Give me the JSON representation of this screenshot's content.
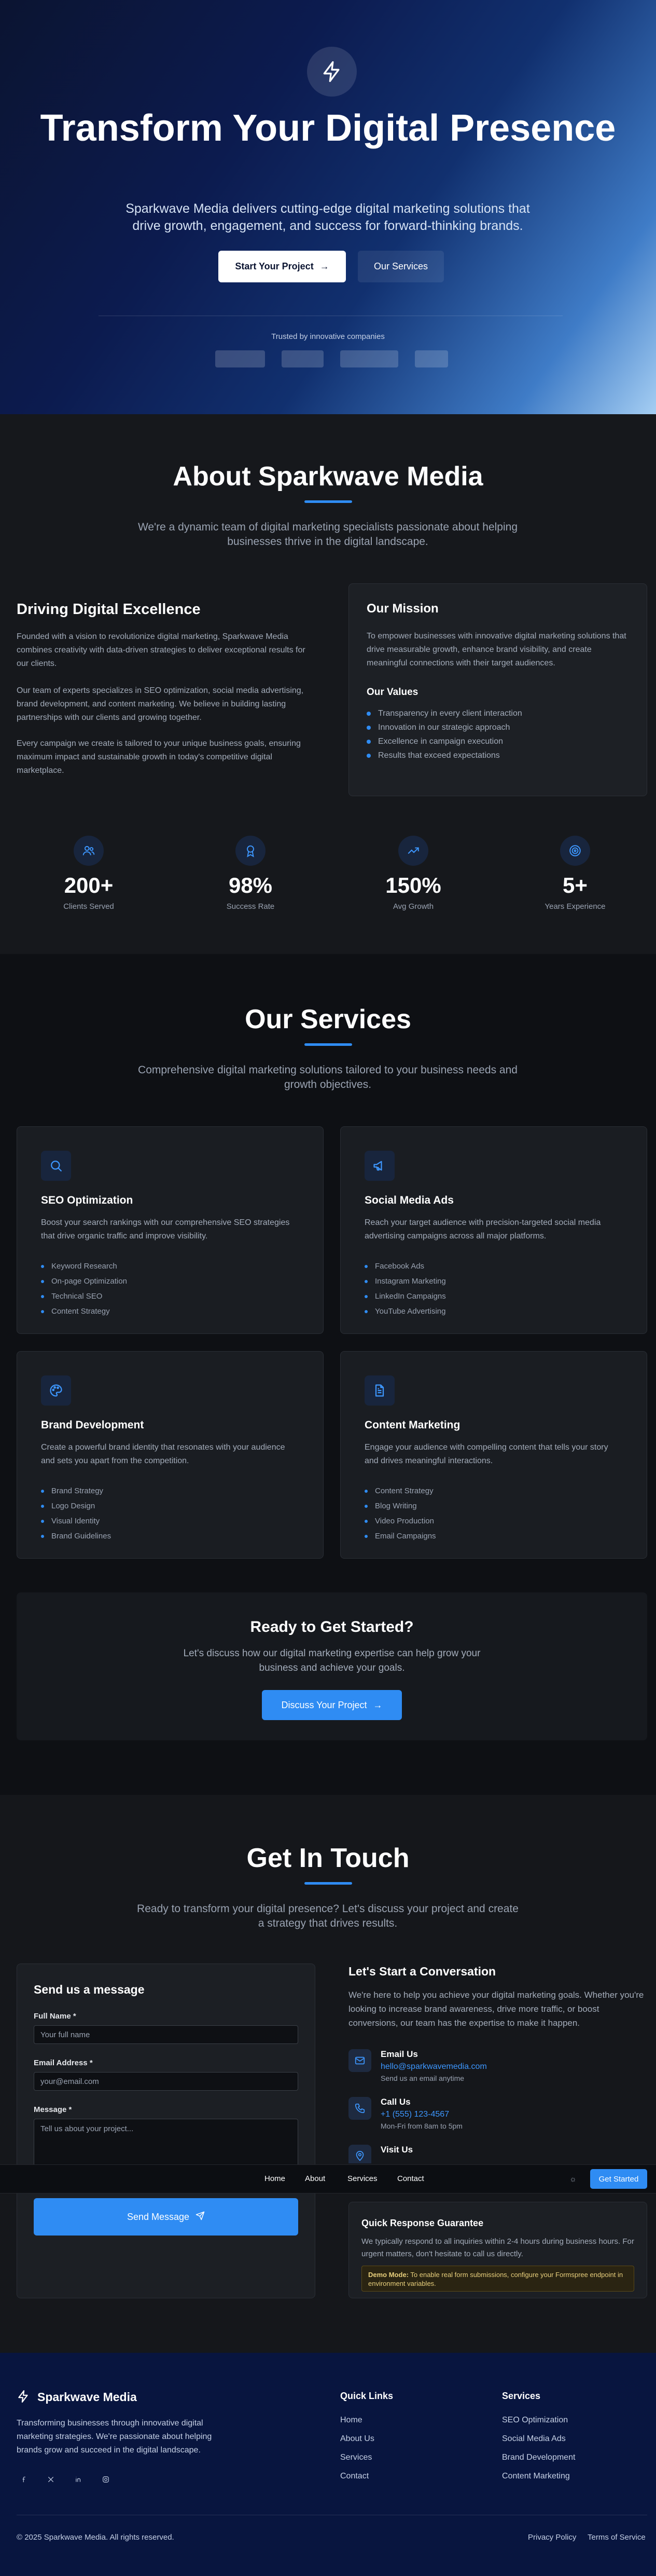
{
  "hero": {
    "icon": "lightning-icon",
    "title": "Transform Your Digital Presence",
    "subtitle": "Sparkwave Media delivers cutting-edge digital marketing solutions that drive growth, engagement, and success for forward-thinking brands.",
    "primary_button": "Start Your Project",
    "secondary_button": "Our Services",
    "trusted_label": "Trusted by innovative companies"
  },
  "about": {
    "title": "About Sparkwave Media",
    "subtitle": "We're a dynamic team of digital marketing specialists passionate about helping businesses thrive in the digital landscape.",
    "heading": "Driving Digital Excellence",
    "paragraphs": [
      "Founded with a vision to revolutionize digital marketing, Sparkwave Media combines creativity with data-driven strategies to deliver exceptional results for our clients.",
      "Our team of experts specializes in SEO optimization, social media advertising, brand development, and content marketing. We believe in building lasting partnerships with our clients and growing together.",
      "Every campaign we create is tailored to your unique business goals, ensuring maximum impact and sustainable growth in today's competitive digital marketplace."
    ],
    "mission": {
      "title": "Our Mission",
      "text": "To empower businesses with innovative digital marketing solutions that drive measurable growth, enhance brand visibility, and create meaningful connections with their target audiences.",
      "values_title": "Our Values",
      "values": [
        "Transparency in every client interaction",
        "Innovation in our strategic approach",
        "Excellence in campaign execution",
        "Results that exceed expectations"
      ]
    },
    "stats": [
      {
        "icon": "users-icon",
        "value": "200+",
        "label": "Clients Served"
      },
      {
        "icon": "award-icon",
        "value": "98%",
        "label": "Success Rate"
      },
      {
        "icon": "trending-up-icon",
        "value": "150%",
        "label": "Avg Growth"
      },
      {
        "icon": "target-icon",
        "value": "5+",
        "label": "Years Experience"
      }
    ]
  },
  "services": {
    "title": "Our Services",
    "subtitle": "Comprehensive digital marketing solutions tailored to your business needs and growth objectives.",
    "items": [
      {
        "icon": "search-icon",
        "title": "SEO Optimization",
        "desc": "Boost your search rankings with our comprehensive SEO strategies that drive organic traffic and improve visibility.",
        "features": [
          "Keyword Research",
          "On-page Optimization",
          "Technical SEO",
          "Content Strategy"
        ]
      },
      {
        "icon": "megaphone-icon",
        "title": "Social Media Ads",
        "desc": "Reach your target audience with precision-targeted social media advertising campaigns across all major platforms.",
        "features": [
          "Facebook Ads",
          "Instagram Marketing",
          "LinkedIn Campaigns",
          "YouTube Advertising"
        ]
      },
      {
        "icon": "palette-icon",
        "title": "Brand Development",
        "desc": "Create a powerful brand identity that resonates with your audience and sets you apart from the competition.",
        "features": [
          "Brand Strategy",
          "Logo Design",
          "Visual Identity",
          "Brand Guidelines"
        ]
      },
      {
        "icon": "document-icon",
        "title": "Content Marketing",
        "desc": "Engage your audience with compelling content that tells your story and drives meaningful interactions.",
        "features": [
          "Content Strategy",
          "Blog Writing",
          "Video Production",
          "Email Campaigns"
        ]
      }
    ],
    "cta": {
      "title": "Ready to Get Started?",
      "text": "Let's discuss how our digital marketing expertise can help grow your business and achieve your goals.",
      "button": "Discuss Your Project"
    }
  },
  "contact": {
    "title": "Get In Touch",
    "subtitle": "Ready to transform your digital presence? Let's discuss your project and create a strategy that drives results.",
    "form": {
      "title": "Send us a message",
      "name_label": "Full Name *",
      "name_placeholder": "Your full name",
      "email_label": "Email Address *",
      "email_placeholder": "your@email.com",
      "message_label": "Message *",
      "message_placeholder": "Tell us about your project...",
      "submit": "Send Message"
    },
    "conversation": {
      "title": "Let's Start a Conversation",
      "text": "We're here to help you achieve your digital marketing goals. Whether you're looking to increase brand awareness, drive more traffic, or boost conversions, our team has the expertise to make it happen.",
      "email_title": "Email Us",
      "email_value": "hello@sparkwavemedia.com",
      "email_sub": "Send us an email anytime",
      "call_title": "Call Us",
      "call_value": "+1 (555) 123-4567",
      "call_sub": "Mon-Fri from 8am to 5pm",
      "visit_title": "Visit Us"
    },
    "guarantee": {
      "title": "Quick Response Guarantee",
      "text": "We typically respond to all inquiries within 2-4 hours during business hours. For urgent matters, don't hesitate to call us directly.",
      "demo_label": "Demo Mode:",
      "demo_text": "To enable real form submissions, configure your Formspree endpoint in environment variables."
    }
  },
  "navbar": {
    "links": [
      "Home",
      "About",
      "Services",
      "Contact"
    ],
    "button": "Get Started"
  },
  "footer": {
    "brand": "Sparkwave Media",
    "description": "Transforming businesses through innovative digital marketing strategies. We're passionate about helping brands grow and succeed in the digital landscape.",
    "quick_links_title": "Quick Links",
    "quick_links": [
      "Home",
      "About Us",
      "Services",
      "Contact"
    ],
    "services_title": "Services",
    "services_links": [
      "SEO Optimization",
      "Social Media Ads",
      "Brand Development",
      "Content Marketing"
    ],
    "social_icons": [
      "facebook-icon",
      "twitter-icon",
      "linkedin-icon",
      "instagram-icon"
    ],
    "copyright": "© 2025 Sparkwave Media. All rights reserved.",
    "privacy": "Privacy Policy",
    "terms": "Terms of Service"
  },
  "colors": {
    "accent": "#2f8cf3",
    "hero_dark": "#0b1431",
    "hero_light": "#a5cef3",
    "footer_bg": "#08153f"
  }
}
